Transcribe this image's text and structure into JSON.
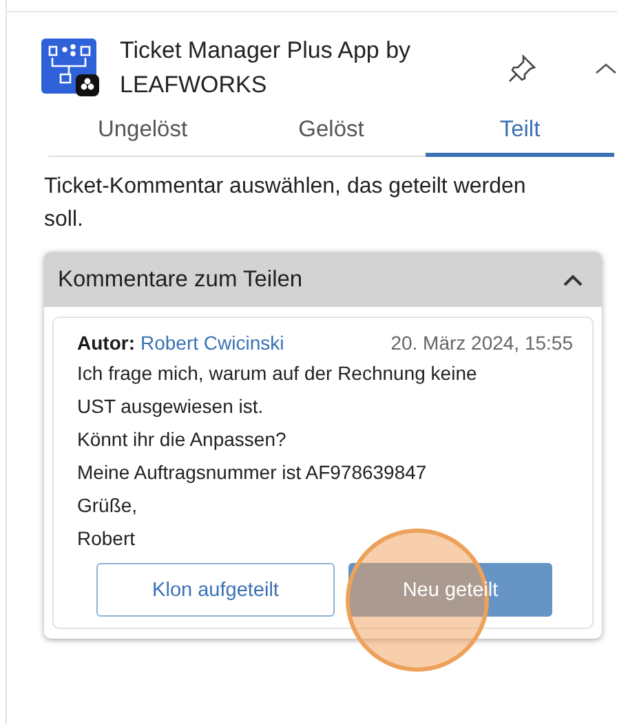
{
  "app": {
    "title": "Ticket Manager Plus App by LEAFWORKS"
  },
  "tabs": [
    {
      "label": "Ungelöst",
      "selected": false
    },
    {
      "label": "Gelöst",
      "selected": false
    },
    {
      "label": "Teilt",
      "selected": true
    }
  ],
  "instruction": "Ticket-Kommentar auswählen, das geteilt werden soll.",
  "section": {
    "title": "Kommentare zum Teilen",
    "expanded": true,
    "comment": {
      "author_label": "Autor:",
      "author": "Robert Cwicinski",
      "date": "20. März 2024, 15:55",
      "lines": [
        "Ich frage mich, warum auf der Rechnung keine UST ausgewiesen ist.",
        "Könnt ihr die Anpassen?",
        "Meine Auftragsnummer ist AF978639847",
        "Grüße,",
        "Robert"
      ],
      "buttons": [
        {
          "label": "Klon aufgeteilt",
          "kind": "outline",
          "click_highlight": false
        },
        {
          "label": "Neu geteilt",
          "kind": "primary",
          "click_highlight": true
        }
      ]
    }
  }
}
